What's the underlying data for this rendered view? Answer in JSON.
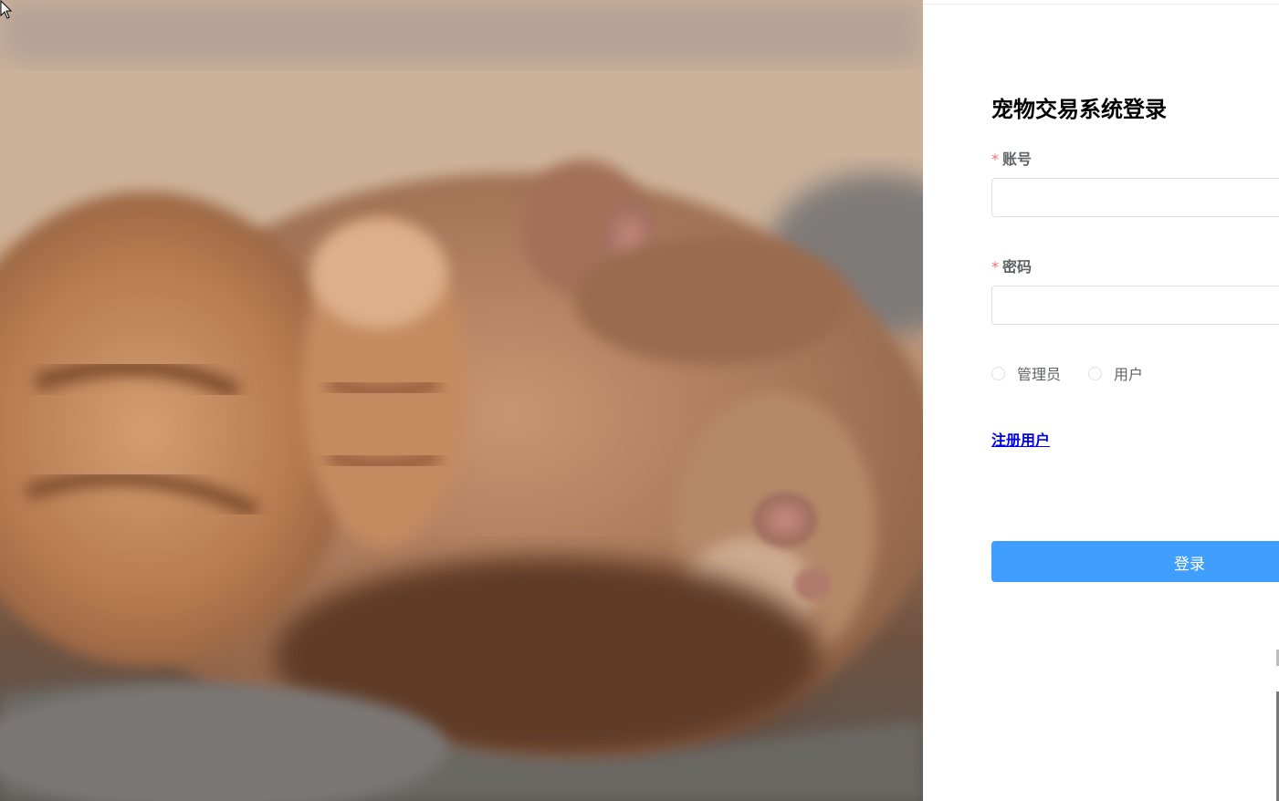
{
  "login": {
    "title": "宠物交易系统登录",
    "account_label": "账号",
    "password_label": "密码",
    "required_mark": "*",
    "account_value": "",
    "password_value": "",
    "roles": [
      {
        "label": "管理员",
        "checked": false
      },
      {
        "label": "用户",
        "checked": false
      }
    ],
    "register_link": "注册用户",
    "login_button": "登录"
  },
  "colors": {
    "primary": "#409eff",
    "required": "#f56c6c",
    "link": "#0000ee",
    "label": "#606266",
    "border": "#dcdfe6"
  },
  "hero": {
    "image_subject": "kitten-photo"
  }
}
